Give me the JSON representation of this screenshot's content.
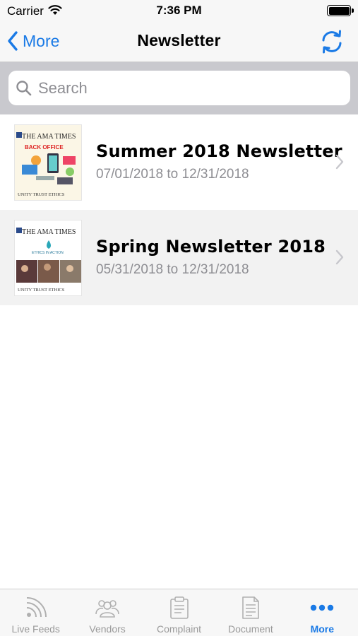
{
  "status_bar": {
    "carrier": "Carrier",
    "time": "7:36 PM"
  },
  "nav": {
    "back_label": "More",
    "title": "Newsletter"
  },
  "search": {
    "placeholder": "Search",
    "value": ""
  },
  "newsletters": [
    {
      "title": "Summer 2018 Newsletter",
      "date_range": "07/01/2018 to 12/31/2018",
      "thumb": {
        "masthead": "THE AMA TIMES",
        "feature": "BACK OFFICE",
        "footer": "UNITY  TRUST  ETHICS"
      }
    },
    {
      "title": "Spring Newsletter 2018",
      "date_range": "05/31/2018 to 12/31/2018",
      "thumb": {
        "masthead": "THE AMA TIMES",
        "feature": "ETHICS IN ACTION",
        "footer": "UNITY  TRUST  ETHICS"
      }
    }
  ],
  "tabs": [
    {
      "label": "Live Feeds",
      "icon": "rss-icon"
    },
    {
      "label": "Vendors",
      "icon": "group-icon"
    },
    {
      "label": "Complaint",
      "icon": "clipboard-icon"
    },
    {
      "label": "Document",
      "icon": "document-icon"
    },
    {
      "label": "More",
      "icon": "more-dots-icon"
    }
  ],
  "colors": {
    "accent": "#1a7ae6",
    "inactive_tab": "#9a9a9a",
    "subtitle": "#8e8e93",
    "search_bg": "#c9c9ce"
  }
}
